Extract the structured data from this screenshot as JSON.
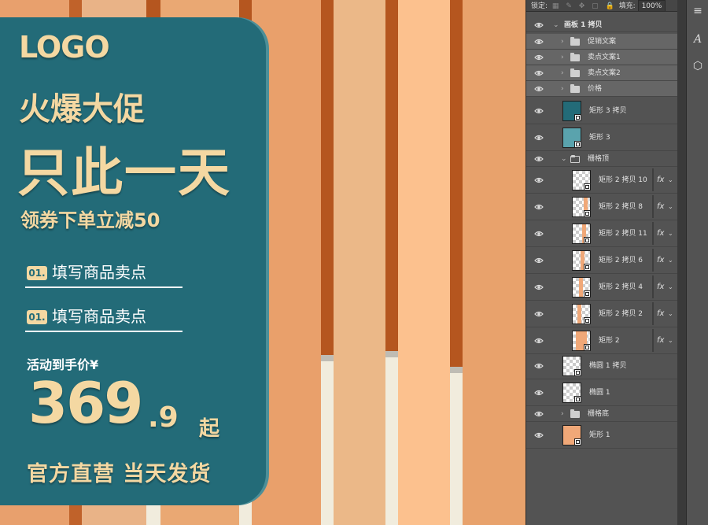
{
  "artwork": {
    "logo": "LOGO",
    "headline_1": "火爆大促",
    "headline_2": "只此一天",
    "subhead": "领券下单立减50",
    "points": [
      {
        "num": "01.",
        "text": "填写商品卖点"
      },
      {
        "num": "01.",
        "text": "填写商品卖点"
      }
    ],
    "price_label": "活动到手价¥",
    "price_integer": "369",
    "price_decimal": ".9",
    "price_unit": "起",
    "footer": "官方直营 当天发货",
    "colors": {
      "banner": "#236b78",
      "gold": "#f4d8a2",
      "background": "#e8a06d",
      "rust": "#b5561f",
      "cream": "#f1ecdd"
    }
  },
  "layers_panel": {
    "lock_label": "锁定:",
    "fill_label": "填充:",
    "fill_value": "100%",
    "layers": [
      {
        "name": "画板 1 拷贝",
        "type": "artboard",
        "selected": false
      },
      {
        "name": "促销文案",
        "type": "group",
        "selected": true
      },
      {
        "name": "卖点文案1",
        "type": "group",
        "selected": true
      },
      {
        "name": "卖点文案2",
        "type": "group",
        "selected": true
      },
      {
        "name": "价格",
        "type": "group",
        "selected": true
      },
      {
        "name": "矩形 3 拷贝",
        "type": "shape",
        "selected": false
      },
      {
        "name": "矩形 3",
        "type": "shape",
        "selected": false
      },
      {
        "name": "栅格顶",
        "type": "group-open",
        "selected": false
      },
      {
        "name": "矩形 2 拷贝 10",
        "type": "shape-fx",
        "selected": false
      },
      {
        "name": "矩形 2 拷贝 8",
        "type": "shape-fx",
        "selected": false
      },
      {
        "name": "矩形 2 拷贝 11",
        "type": "shape-fx",
        "selected": false
      },
      {
        "name": "矩形 2 拷贝 6",
        "type": "shape-fx",
        "selected": false
      },
      {
        "name": "矩形 2 拷贝 4",
        "type": "shape-fx",
        "selected": false
      },
      {
        "name": "矩形 2 拷贝 2",
        "type": "shape-fx",
        "selected": false
      },
      {
        "name": "矩形 2",
        "type": "shape-fx",
        "selected": false
      },
      {
        "name": "椭圆 1 拷贝",
        "type": "shape",
        "selected": false
      },
      {
        "name": "椭圆 1",
        "type": "shape",
        "selected": false
      },
      {
        "name": "栅格底",
        "type": "group",
        "selected": false
      },
      {
        "name": "矩形 1",
        "type": "shape",
        "selected": false
      }
    ],
    "fx_label": "fx"
  },
  "toolbar": {
    "icons": [
      "adjustments-icon",
      "character-icon",
      "3d-cube-icon"
    ],
    "glyphs": [
      "≡",
      "A",
      "⬡"
    ]
  }
}
